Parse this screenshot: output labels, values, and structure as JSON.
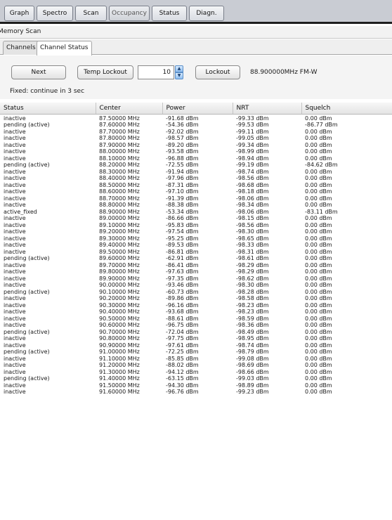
{
  "top_tabs": [
    {
      "label": "Graph"
    },
    {
      "label": "Spectro"
    },
    {
      "label": "Scan"
    },
    {
      "label": "Occupancy"
    },
    {
      "label": "Status"
    },
    {
      "label": "Diagn."
    }
  ],
  "panel_title": "Memory Scan",
  "sub_tabs": [
    {
      "label": "Channels",
      "active": false
    },
    {
      "label": "Channel Status",
      "active": true
    }
  ],
  "controls": {
    "next_label": "Next",
    "temp_lockout_label": "Temp Lockout",
    "lockout_seconds": "10",
    "lockout_label": "Lockout",
    "current_frequency": "88.900000MHz FM-W",
    "fixed_status": "Fixed: continue in 3 sec"
  },
  "table": {
    "columns": [
      "Status",
      "Center",
      "Power",
      "NRT",
      "Squelch"
    ],
    "rows": [
      [
        "inactive",
        "87.50000 MHz",
        "-91.68 dBm",
        "-99.33 dBm",
        "0.00 dBm"
      ],
      [
        "pending (active)",
        "87.60000 MHz",
        "-54.36 dBm",
        "-99.53 dBm",
        "-86.77 dBm"
      ],
      [
        "inactive",
        "87.70000 MHz",
        "-92.02 dBm",
        "-99.11 dBm",
        "0.00 dBm"
      ],
      [
        "inactive",
        "87.80000 MHz",
        "-98.57 dBm",
        "-99.05 dBm",
        "0.00 dBm"
      ],
      [
        "inactive",
        "87.90000 MHz",
        "-89.20 dBm",
        "-99.34 dBm",
        "0.00 dBm"
      ],
      [
        "inactive",
        "88.00000 MHz",
        "-93.58 dBm",
        "-98.99 dBm",
        "0.00 dBm"
      ],
      [
        "inactive",
        "88.10000 MHz",
        "-96.88 dBm",
        "-98.94 dBm",
        "0.00 dBm"
      ],
      [
        "pending (active)",
        "88.20000 MHz",
        "-72.55 dBm",
        "-99.19 dBm",
        "-84.62 dBm"
      ],
      [
        "inactive",
        "88.30000 MHz",
        "-91.94 dBm",
        "-98.74 dBm",
        "0.00 dBm"
      ],
      [
        "inactive",
        "88.40000 MHz",
        "-97.96 dBm",
        "-98.56 dBm",
        "0.00 dBm"
      ],
      [
        "inactive",
        "88.50000 MHz",
        "-87.31 dBm",
        "-98.68 dBm",
        "0.00 dBm"
      ],
      [
        "inactive",
        "88.60000 MHz",
        "-97.10 dBm",
        "-98.18 dBm",
        "0.00 dBm"
      ],
      [
        "inactive",
        "88.70000 MHz",
        "-91.39 dBm",
        "-98.06 dBm",
        "0.00 dBm"
      ],
      [
        "inactive",
        "88.80000 MHz",
        "-88.38 dBm",
        "-98.34 dBm",
        "0.00 dBm"
      ],
      [
        "active_fixed",
        "88.90000 MHz",
        "-53.34 dBm",
        "-98.06 dBm",
        "-83.11 dBm"
      ],
      [
        "inactive",
        "89.00000 MHz",
        "-86.66 dBm",
        "-98.15 dBm",
        "0.00 dBm"
      ],
      [
        "inactive",
        "89.10000 MHz",
        "-95.83 dBm",
        "-98.56 dBm",
        "0.00 dBm"
      ],
      [
        "inactive",
        "89.20000 MHz",
        "-97.54 dBm",
        "-98.30 dBm",
        "0.00 dBm"
      ],
      [
        "inactive",
        "89.30000 MHz",
        "-95.25 dBm",
        "-98.65 dBm",
        "0.00 dBm"
      ],
      [
        "inactive",
        "89.40000 MHz",
        "-89.53 dBm",
        "-98.33 dBm",
        "0.00 dBm"
      ],
      [
        "inactive",
        "89.50000 MHz",
        "-86.81 dBm",
        "-98.31 dBm",
        "0.00 dBm"
      ],
      [
        "pending (active)",
        "89.60000 MHz",
        "-62.91 dBm",
        "-98.61 dBm",
        "0.00 dBm"
      ],
      [
        "inactive",
        "89.70000 MHz",
        "-86.41 dBm",
        "-98.29 dBm",
        "0.00 dBm"
      ],
      [
        "inactive",
        "89.80000 MHz",
        "-97.63 dBm",
        "-98.29 dBm",
        "0.00 dBm"
      ],
      [
        "inactive",
        "89.90000 MHz",
        "-97.35 dBm",
        "-98.62 dBm",
        "0.00 dBm"
      ],
      [
        "inactive",
        "90.00000 MHz",
        "-93.46 dBm",
        "-98.30 dBm",
        "0.00 dBm"
      ],
      [
        "pending (active)",
        "90.10000 MHz",
        "-60.73 dBm",
        "-98.28 dBm",
        "0.00 dBm"
      ],
      [
        "inactive",
        "90.20000 MHz",
        "-89.86 dBm",
        "-98.58 dBm",
        "0.00 dBm"
      ],
      [
        "inactive",
        "90.30000 MHz",
        "-96.16 dBm",
        "-98.23 dBm",
        "0.00 dBm"
      ],
      [
        "inactive",
        "90.40000 MHz",
        "-93.68 dBm",
        "-98.23 dBm",
        "0.00 dBm"
      ],
      [
        "inactive",
        "90.50000 MHz",
        "-88.61 dBm",
        "-98.59 dBm",
        "0.00 dBm"
      ],
      [
        "inactive",
        "90.60000 MHz",
        "-96.75 dBm",
        "-98.36 dBm",
        "0.00 dBm"
      ],
      [
        "pending (active)",
        "90.70000 MHz",
        "-72.04 dBm",
        "-98.49 dBm",
        "0.00 dBm"
      ],
      [
        "inactive",
        "90.80000 MHz",
        "-97.75 dBm",
        "-98.95 dBm",
        "0.00 dBm"
      ],
      [
        "inactive",
        "90.90000 MHz",
        "-97.61 dBm",
        "-98.74 dBm",
        "0.00 dBm"
      ],
      [
        "pending (active)",
        "91.00000 MHz",
        "-72.25 dBm",
        "-98.79 dBm",
        "0.00 dBm"
      ],
      [
        "inactive",
        "91.10000 MHz",
        "-85.85 dBm",
        "-99.08 dBm",
        "0.00 dBm"
      ],
      [
        "inactive",
        "91.20000 MHz",
        "-88.02 dBm",
        "-98.69 dBm",
        "0.00 dBm"
      ],
      [
        "inactive",
        "91.30000 MHz",
        "-94.12 dBm",
        "-98.66 dBm",
        "0.00 dBm"
      ],
      [
        "pending (active)",
        "91.40000 MHz",
        "-63.15 dBm",
        "-99.03 dBm",
        "0.00 dBm"
      ],
      [
        "inactive",
        "91.50000 MHz",
        "-94.30 dBm",
        "-98.89 dBm",
        "0.00 dBm"
      ],
      [
        "inactive",
        "91.60000 MHz",
        "-96.76 dBm",
        "-99.23 dBm",
        "0.00 dBm"
      ]
    ]
  }
}
